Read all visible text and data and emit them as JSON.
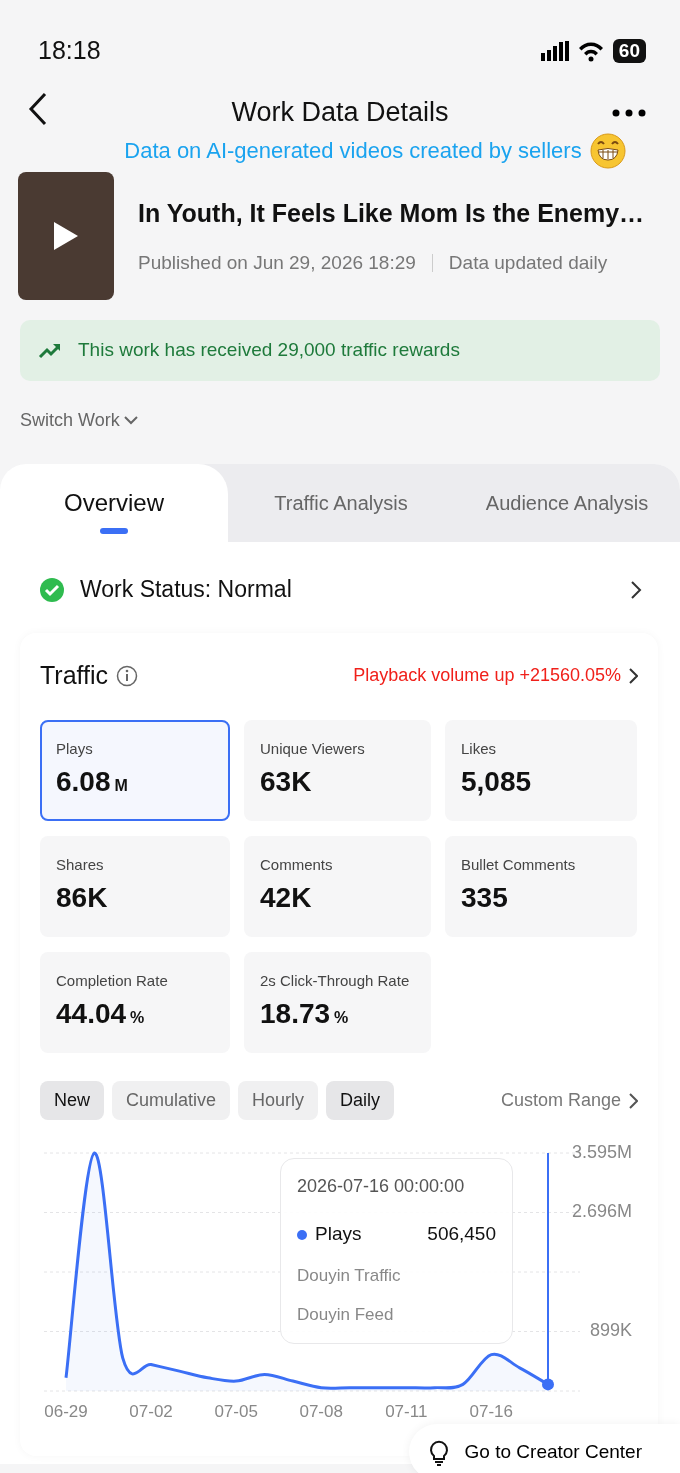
{
  "status_bar": {
    "time": "18:18",
    "battery": "60"
  },
  "header": {
    "title": "Work Data Details",
    "subtitle": "Data on AI-generated videos created by sellers"
  },
  "work": {
    "title": "In Youth, It Feels Like Mom Is the Enemy…",
    "published": "Published on Jun 29, 2026 18:29",
    "update_note": "Data updated daily"
  },
  "reward_banner": "This work has received 29,000 traffic rewards",
  "switch_work": "Switch Work",
  "tabs": [
    {
      "label": "Overview",
      "selected": true
    },
    {
      "label": "Traffic Analysis",
      "selected": false
    },
    {
      "label": "Audience Analysis",
      "selected": false
    }
  ],
  "work_status": "Work Status: Normal",
  "traffic": {
    "title": "Traffic",
    "trend": "Playback volume up +21560.05%",
    "metrics": [
      {
        "label": "Plays",
        "value": "6.08",
        "unit": "M",
        "selected": true
      },
      {
        "label": "Unique Viewers",
        "value": "63K",
        "selected": false
      },
      {
        "label": "Likes",
        "value": "5,085",
        "selected": false
      },
      {
        "label": "Shares",
        "value": "86K",
        "selected": false
      },
      {
        "label": "Comments",
        "value": "42K",
        "selected": false
      },
      {
        "label": "Bullet Comments",
        "value": "335",
        "selected": false
      },
      {
        "label": "Completion Rate",
        "value": "44.04",
        "unit": "%",
        "selected": false
      },
      {
        "label": "2s Click-Through Rate",
        "value": "18.73",
        "unit": "%",
        "selected": false
      }
    ],
    "mode_toggles": [
      {
        "label": "New",
        "selected": true
      },
      {
        "label": "Cumulative",
        "selected": false
      }
    ],
    "period_toggles": [
      {
        "label": "Hourly",
        "selected": false
      },
      {
        "label": "Daily",
        "selected": true
      }
    ],
    "custom_range": "Custom Range",
    "chart_data": {
      "type": "area",
      "categories": [
        "06-29",
        null,
        null,
        "07-02",
        null,
        null,
        "07-05",
        null,
        null,
        "07-08",
        null,
        null,
        "07-11",
        null,
        null,
        "07-16",
        null,
        null
      ],
      "series": [
        {
          "name": "Plays",
          "color": "#3b6ff5",
          "values": [
            200000,
            3595000,
            500000,
            400000,
            300000,
            200000,
            150000,
            250000,
            150000,
            50000,
            50000,
            50000,
            50000,
            50000,
            100000,
            550000,
            350000,
            100000
          ]
        }
      ],
      "ylim": [
        0,
        3595000
      ],
      "yticks": [
        {
          "value": 899000,
          "label": "899K"
        },
        {
          "value": 2696000,
          "label": "2.696M"
        },
        {
          "value": 3595000,
          "label": "3.595M"
        }
      ]
    },
    "tooltip": {
      "time": "2026-07-16 00:00:00",
      "value": "506,450",
      "lines": [
        "Douyin Traffic",
        "Douyin Feed"
      ]
    }
  },
  "creator_center_button": "Go to Creator Center"
}
